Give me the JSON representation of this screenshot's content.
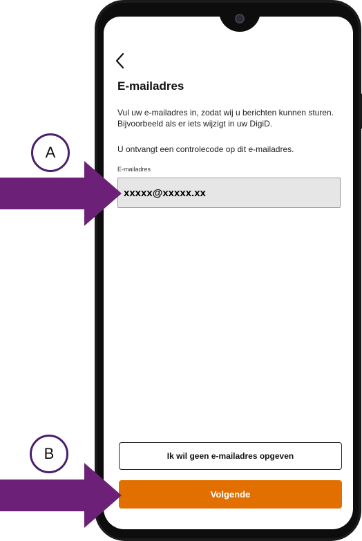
{
  "screen": {
    "title": "E-mailadres",
    "intro_text": "Vul uw e-mailadres in, zodat wij u berichten kunnen sturen. Bijvoorbeeld als er iets wijzigt in uw DigiD.",
    "code_text": "U ontvangt een controlecode op dit e-mailadres.",
    "email_label": "E-mailadres",
    "email_value": "xxxxx@xxxxx.xx"
  },
  "buttons": {
    "skip_label": "Ik wil geen e-mailadres opgeven",
    "next_label": "Volgende"
  },
  "annotations": {
    "marker_a": "A",
    "marker_b": "B"
  },
  "colors": {
    "primary_button": "#e17000",
    "arrow": "#6d2077",
    "input_background": "#e6e6e6"
  },
  "icons": {
    "back": "chevron-left-icon",
    "camera": "front-camera-icon"
  }
}
